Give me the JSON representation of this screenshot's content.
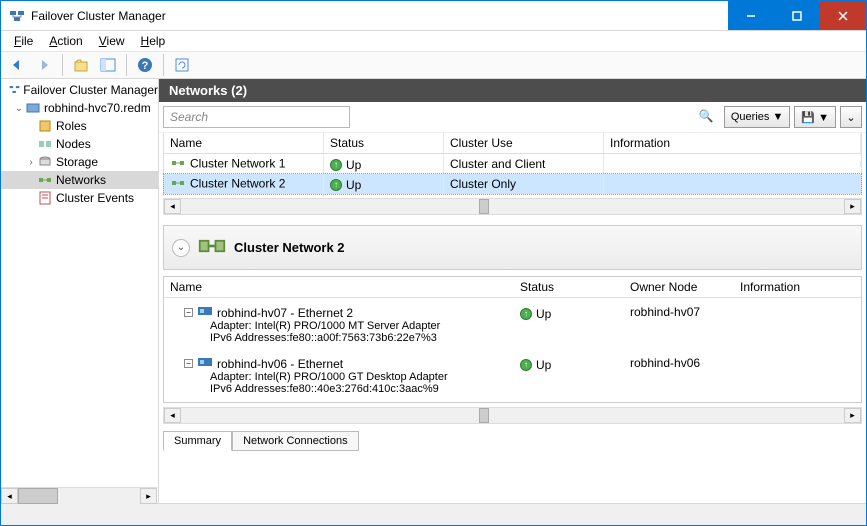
{
  "window": {
    "title": "Failover Cluster Manager"
  },
  "menu": {
    "file": "File",
    "action": "Action",
    "view": "View",
    "help": "Help"
  },
  "tree": {
    "root": "Failover Cluster Manager",
    "cluster": "robhind-hvc70.redm",
    "roles": "Roles",
    "nodes": "Nodes",
    "storage": "Storage",
    "networks": "Networks",
    "events": "Cluster Events"
  },
  "panel": {
    "title": "Networks (2)"
  },
  "search": {
    "placeholder": "Search",
    "queries": "Queries"
  },
  "list": {
    "cols": {
      "name": "Name",
      "status": "Status",
      "use": "Cluster Use",
      "info": "Information"
    },
    "rows": [
      {
        "name": "Cluster Network 1",
        "status": "Up",
        "use": "Cluster and Client",
        "info": ""
      },
      {
        "name": "Cluster Network 2",
        "status": "Up",
        "use": "Cluster Only",
        "info": ""
      }
    ]
  },
  "detail": {
    "title": "Cluster Network 2"
  },
  "conn": {
    "cols": {
      "name": "Name",
      "status": "Status",
      "owner": "Owner Node",
      "info": "Information"
    },
    "items": [
      {
        "name": "robhind-hv07 - Ethernet 2",
        "adapter": "Adapter: Intel(R) PRO/1000 MT Server Adapter",
        "ipv6": "IPv6 Addresses:fe80::a00f:7563:73b6:22e7%3",
        "status": "Up",
        "owner": "robhind-hv07"
      },
      {
        "name": "robhind-hv06 - Ethernet",
        "adapter": "Adapter: Intel(R) PRO/1000 GT Desktop Adapter",
        "ipv6": "IPv6 Addresses:fe80::40e3:276d:410c:3aac%9",
        "status": "Up",
        "owner": "robhind-hv06"
      }
    ]
  },
  "tabs": {
    "summary": "Summary",
    "connections": "Network Connections"
  }
}
